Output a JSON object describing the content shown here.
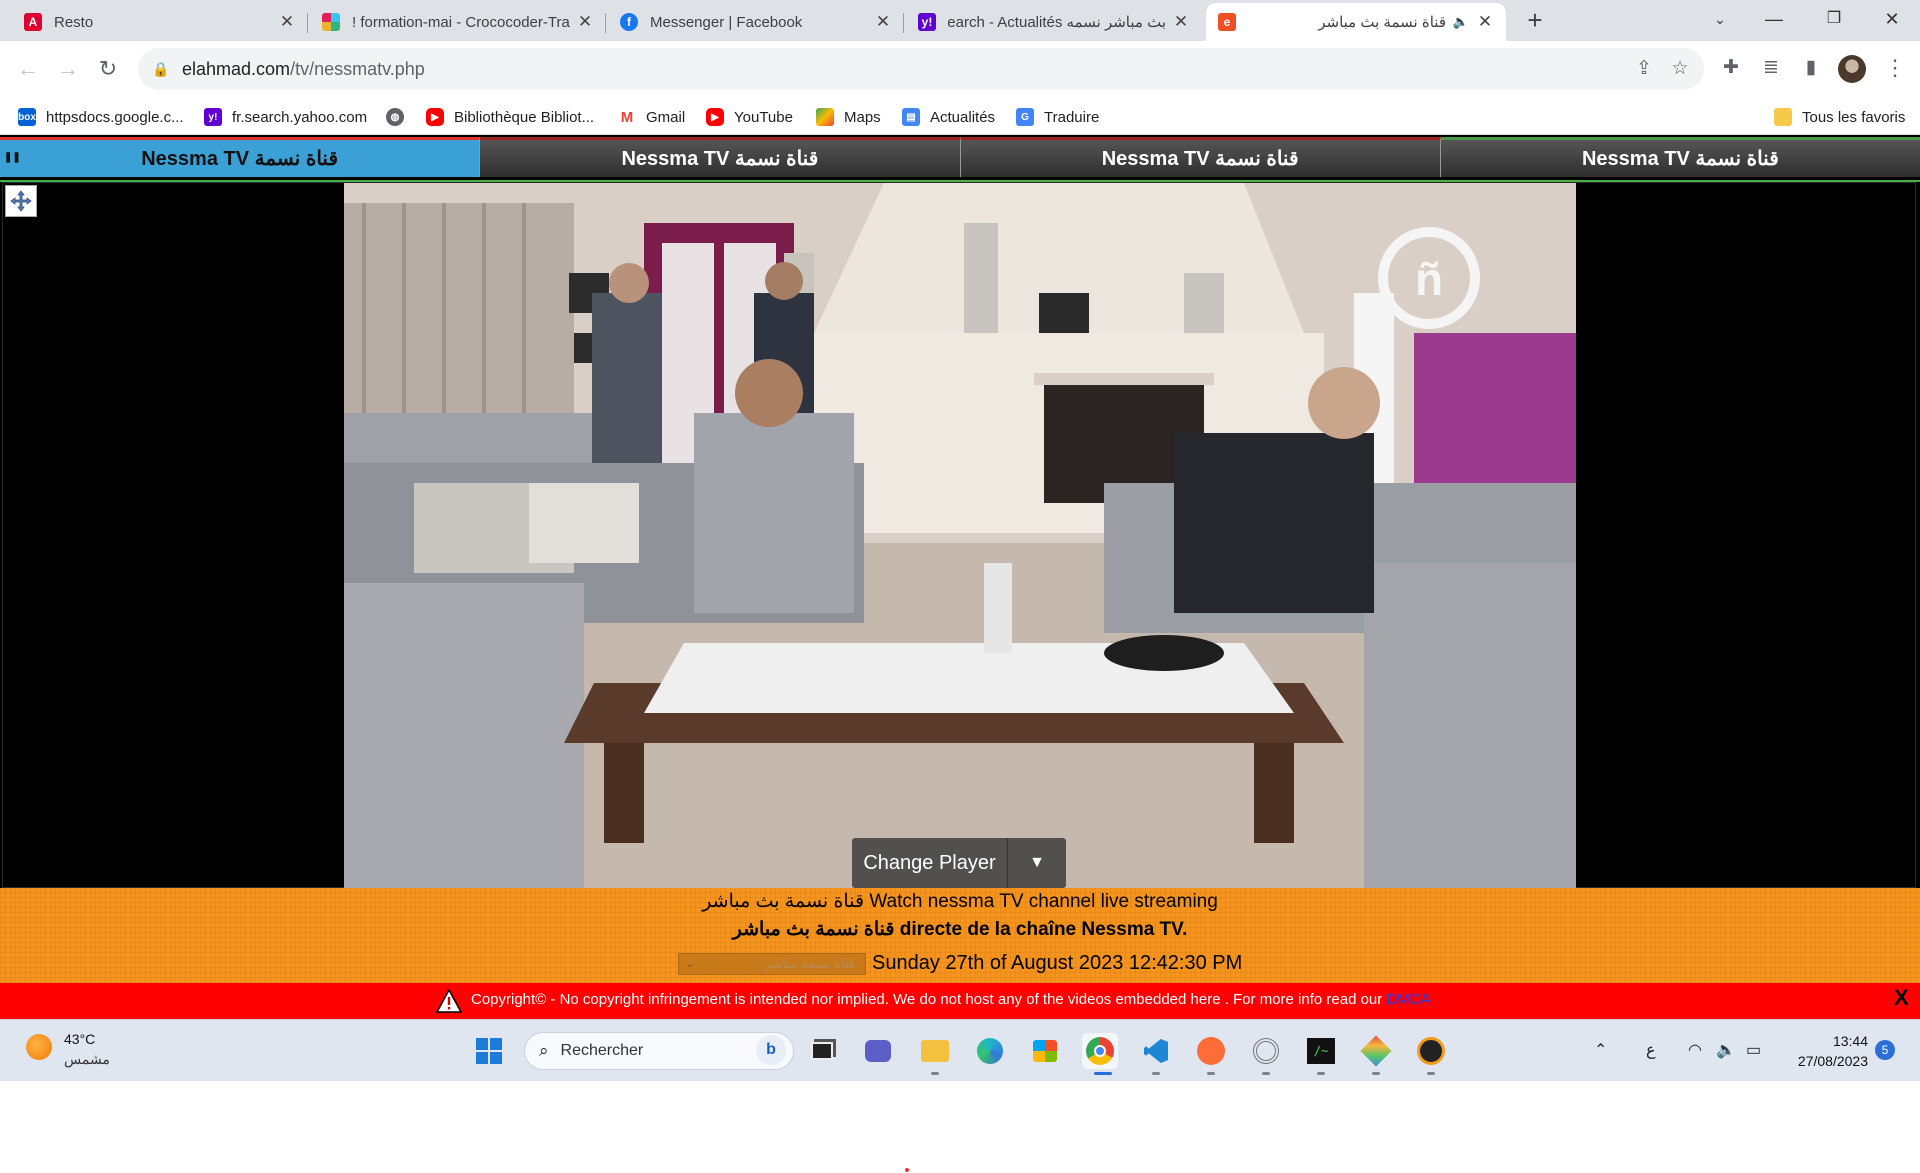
{
  "browser": {
    "tabs": [
      {
        "title": "Resto",
        "icon": "angular-icon",
        "color": "#dd0031"
      },
      {
        "title": "! formation-mai - Crococoder-Tra",
        "icon": "slack-icon",
        "color": "#4a154b"
      },
      {
        "title": "Messenger | Facebook",
        "icon": "facebook-icon",
        "color": "#1877f2"
      },
      {
        "title": "بث مباشر نسمه search - Actualités",
        "icon": "yahoo-icon",
        "color": "#6001d2"
      },
      {
        "title": "قناة نسمة بث مباشر",
        "icon": "site-icon",
        "color": "#f04e23",
        "active": true
      }
    ],
    "url_host": "elahmad.com",
    "url_path": "/tv/nessmatv.php",
    "bookmarks": [
      {
        "label": "httpsdocs.google.c...",
        "icon": "box-icon",
        "color": "#0061d5"
      },
      {
        "label": "fr.search.yahoo.com",
        "icon": "yahoo-icon",
        "color": "#6001d2"
      },
      {
        "label": "",
        "icon": "globe-icon",
        "color": "#5f6368"
      },
      {
        "label": "Bibliothèque Bibliot...",
        "icon": "youtube-icon",
        "color": "#ff0000"
      },
      {
        "label": "Gmail",
        "icon": "gmail-icon",
        "color": "#ea4335"
      },
      {
        "label": "YouTube",
        "icon": "youtube-icon",
        "color": "#ff0000"
      },
      {
        "label": "Maps",
        "icon": "maps-icon",
        "color": "#34a853"
      },
      {
        "label": "Actualités",
        "icon": "news-icon",
        "color": "#4285f4"
      },
      {
        "label": "Traduire",
        "icon": "translate-icon",
        "color": "#4285f4"
      }
    ],
    "all_bookmarks": "Tous les favoris"
  },
  "page": {
    "channel_tabs": [
      "Nessma TV قناة نسمة",
      "Nessma TV قناة نسمة",
      "Nessma TV قناة نسمة",
      "Nessma TV قناة نسمة"
    ],
    "change_player": "Change Player",
    "change_player_arrow": "▼",
    "info_line1": "قناة نسمة بث مباشر Watch nessma TV channel live streaming",
    "info_line2": "قناة نسمة بث مباشر directe de la chaîne Nessma TV.",
    "select_value": "قناة نسمة مباشر",
    "date_text": "Sunday 27th of August 2023 12:42:30 PM",
    "copyright_text": "Copyright© - No copyright infringement is intended nor implied. We do not host any of the videos embedded here . For more info read our",
    "copyright_link": "DMCA",
    "close_label": "X"
  },
  "taskbar": {
    "temperature": "43°C",
    "condition": "مشمس",
    "search_placeholder": "Rechercher",
    "keyboard_lang": "ع",
    "time": "13:44",
    "date": "27/08/2023",
    "notification_count": "5"
  },
  "colors": {
    "orange_band": "#f7941d",
    "copyright_bar": "#ff0000",
    "active_channel_tab": "#3aa0d6"
  }
}
